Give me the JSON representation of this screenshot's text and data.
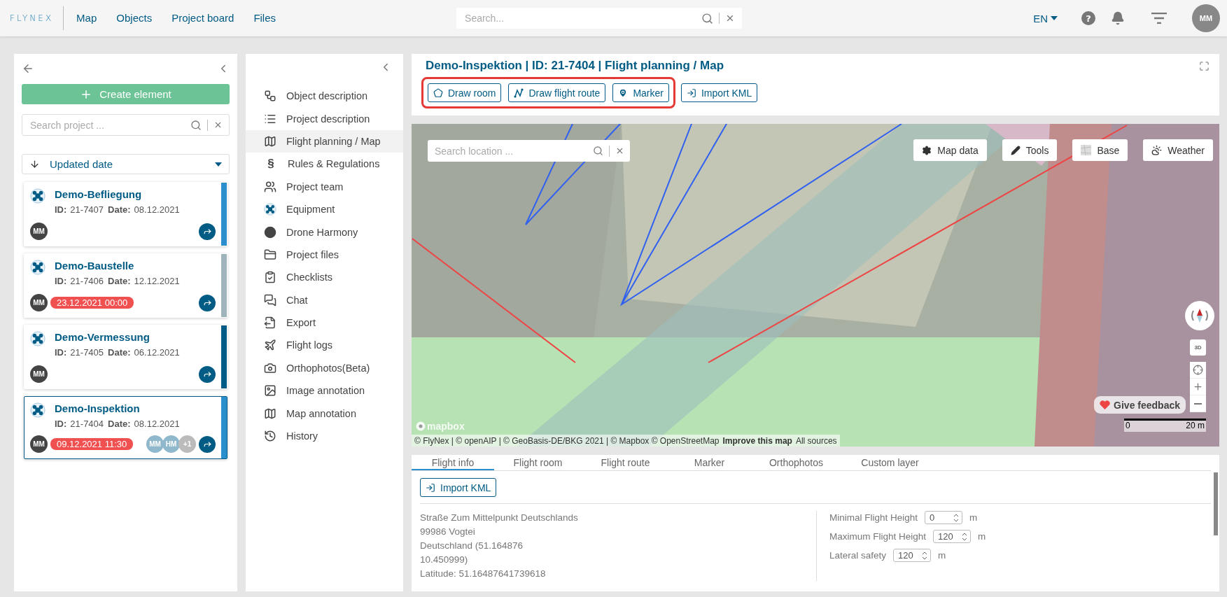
{
  "top_bar": {
    "logo": "FLYNEX",
    "nav": [
      {
        "label": "Map",
        "selected": false
      },
      {
        "label": "Objects",
        "selected": false
      },
      {
        "label": "Project board",
        "selected": false
      },
      {
        "label": "Files",
        "selected": false
      }
    ],
    "search": {
      "placeholder": "Search..."
    },
    "language": "EN",
    "help": "?",
    "avatar": "MM"
  },
  "projects_panel": {
    "create_label": "Create element",
    "search": {
      "placeholder": "Search project ..."
    },
    "sort": {
      "label": "Updated date"
    },
    "projects": [
      {
        "title": "Demo-Befliegung",
        "id_label": "ID:",
        "id": "21-7407",
        "date_label": "Date:",
        "date": "08.12.2021",
        "owner": "MM",
        "color": "#2a8fcc",
        "selected": false
      },
      {
        "title": "Demo-Baustelle",
        "id_label": "ID:",
        "id": "21-7406",
        "date_label": "Date:",
        "date": "12.12.2021",
        "owner": "MM",
        "deadline": "23.12.2021 00:00",
        "color": "#9fb3bd",
        "selected": false
      },
      {
        "title": "Demo-Vermessung",
        "id_label": "ID:",
        "id": "21-7405",
        "date_label": "Date:",
        "date": "06.12.2021",
        "owner": "MM",
        "color": "#005b85",
        "selected": false
      },
      {
        "title": "Demo-Inspektion",
        "id_label": "ID:",
        "id": "21-7404",
        "date_label": "Date:",
        "date": "08.12.2021",
        "owner": "MM",
        "deadline": "09.12.2021 11:30",
        "members": [
          "MM",
          "HM",
          "+1"
        ],
        "color": "#2a8fcc",
        "selected": true
      }
    ]
  },
  "nav_menu": {
    "items": [
      {
        "label": "Object description",
        "selected": false
      },
      {
        "label": "Project description",
        "selected": false
      },
      {
        "label": "Flight planning / Map",
        "selected": true
      },
      {
        "label": "Rules & Regulations",
        "glyph": "§",
        "selected": false
      },
      {
        "label": "Project team",
        "selected": false
      },
      {
        "label": "Equipment",
        "selected": false
      },
      {
        "label": "Drone Harmony",
        "selected": false
      },
      {
        "label": "Project files",
        "selected": false
      },
      {
        "label": "Checklists",
        "selected": false
      },
      {
        "label": "Chat",
        "selected": false
      },
      {
        "label": "Export",
        "selected": false
      },
      {
        "label": "Flight logs",
        "selected": false
      },
      {
        "label": "Orthophotos(Beta)",
        "selected": false
      },
      {
        "label": "Image annotation",
        "selected": false
      },
      {
        "label": "Map annotation",
        "selected": false
      },
      {
        "label": "History",
        "selected": false
      }
    ]
  },
  "main": {
    "title": "Demo-Inspektion | ID: 21-7404 | Flight planning / Map",
    "tools": [
      {
        "label": "Draw room",
        "highlighted": true
      },
      {
        "label": "Draw flight route",
        "highlighted": true
      },
      {
        "label": "Marker",
        "highlighted": true
      },
      {
        "label": "Import KML",
        "highlighted": false
      }
    ]
  },
  "map": {
    "search": {
      "placeholder": "Search location ..."
    },
    "buttons": [
      "Map data",
      "Tools",
      "Base",
      "Weather"
    ],
    "three_d": "3D",
    "feedback": "Give feedback",
    "attribution": {
      "logo": "mapbox",
      "text": "© FlyNex | © openAIP | © GeoBasis-DE/BKG 2021 | © Mapbox © OpenStreetMap",
      "improve": "Improve this map",
      "sources": "All sources"
    },
    "scale": {
      "start": "0",
      "end": "20 m"
    }
  },
  "details": {
    "tabs": [
      {
        "label": "Flight info",
        "selected": true
      },
      {
        "label": "Flight room",
        "selected": false
      },
      {
        "label": "Flight route",
        "selected": false
      },
      {
        "label": "Marker",
        "selected": false
      },
      {
        "label": "Orthophotos",
        "selected": false
      },
      {
        "label": "Custom layer",
        "selected": false
      }
    ],
    "import_label": "Import KML",
    "address": [
      "Straße Zum Mittelpunkt Deutschlands",
      "99986 Vogtei",
      "Deutschland (51.164876",
      "10.450999)",
      "Latitude: 51.16487641739618"
    ],
    "fields": [
      {
        "label": "Minimal Flight Height",
        "value": "0",
        "unit": "m"
      },
      {
        "label": "Maximum Flight Height",
        "value": "120",
        "unit": "m"
      },
      {
        "label": "Lateral safety",
        "value": "120",
        "unit": "m"
      }
    ]
  }
}
